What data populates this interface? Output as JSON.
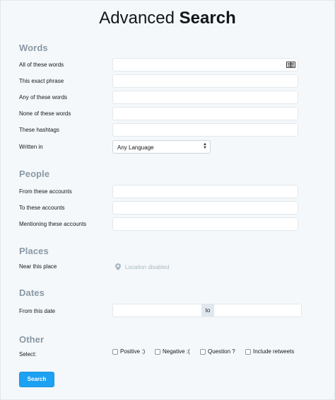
{
  "header": {
    "title_light": "Advanced",
    "title_bold": "Search"
  },
  "words": {
    "title": "Words",
    "all_label": "All of these words",
    "exact_label": "This exact phrase",
    "any_label": "Any of these words",
    "none_label": "None of these words",
    "hashtags_label": "These hashtags",
    "language_label": "Written in",
    "language_value": "Any Language"
  },
  "people": {
    "title": "People",
    "from_label": "From these accounts",
    "to_label": "To these accounts",
    "mentioning_label": "Mentioning these accounts"
  },
  "places": {
    "title": "Places",
    "near_label": "Near this place",
    "location_text": "Location disabled"
  },
  "dates": {
    "title": "Dates",
    "from_label": "From this date",
    "to_text": "to"
  },
  "other": {
    "title": "Other",
    "select_label": "Select:",
    "options": [
      "Positive :)",
      "Negative :(",
      "Question ?",
      "Include retweets"
    ]
  },
  "actions": {
    "search_label": "Search"
  },
  "colors": {
    "accent": "#1da1f2",
    "section": "#8899a6",
    "background": "#f5f8fa"
  }
}
